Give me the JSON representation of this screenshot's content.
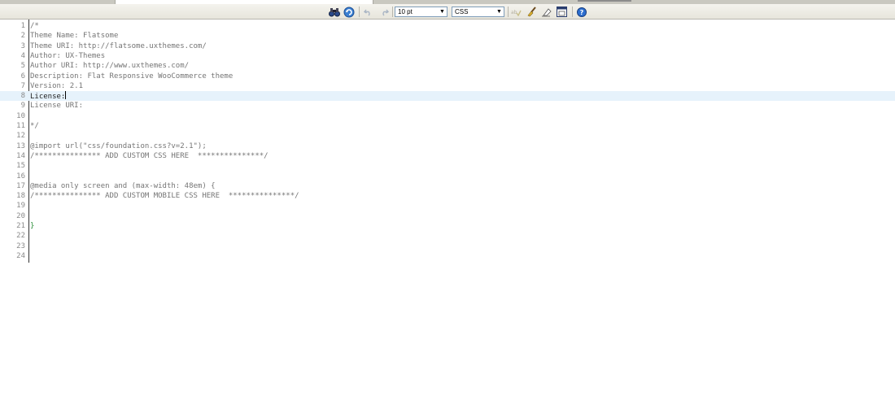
{
  "toolbar": {
    "font_size": "10 pt",
    "syntax": "CSS"
  },
  "editor": {
    "lines": [
      {
        "n": "1",
        "text": "/*"
      },
      {
        "n": "2",
        "text": "Theme Name: Flatsome"
      },
      {
        "n": "3",
        "text": "Theme URI: http://flatsome.uxthemes.com/"
      },
      {
        "n": "4",
        "text": "Author: UX-Themes"
      },
      {
        "n": "5",
        "text": "Author URI: http://www.uxthemes.com/"
      },
      {
        "n": "6",
        "text": "Description: Flat Responsive WooCommerce theme"
      },
      {
        "n": "7",
        "text": "Version: 2.1"
      },
      {
        "n": "8",
        "text": "License:"
      },
      {
        "n": "9",
        "text": "License URI:"
      },
      {
        "n": "10",
        "text": ""
      },
      {
        "n": "11",
        "text": "*/"
      },
      {
        "n": "12",
        "text": ""
      },
      {
        "n": "13",
        "text": "@import url(\"css/foundation.css?v=2.1\");"
      },
      {
        "n": "14",
        "text": "/*************** ADD CUSTOM CSS HERE  ***************/"
      },
      {
        "n": "15",
        "text": ""
      },
      {
        "n": "16",
        "text": ""
      },
      {
        "n": "17",
        "text": "@media only screen and (max-width: 48em) {"
      },
      {
        "n": "18",
        "text": "/*************** ADD CUSTOM MOBILE CSS HERE  ***************/"
      },
      {
        "n": "19",
        "text": ""
      },
      {
        "n": "20",
        "text": ""
      },
      {
        "n": "21",
        "text": "}"
      },
      {
        "n": "22",
        "text": ""
      },
      {
        "n": "23",
        "text": ""
      },
      {
        "n": "24",
        "text": ""
      }
    ],
    "current_line": "8"
  },
  "colors": {
    "toolbar_bg": "#ecebe4",
    "highlight_line": "#e6f2fb",
    "comment_text": "#757575",
    "brace": "#2c8f3a"
  }
}
